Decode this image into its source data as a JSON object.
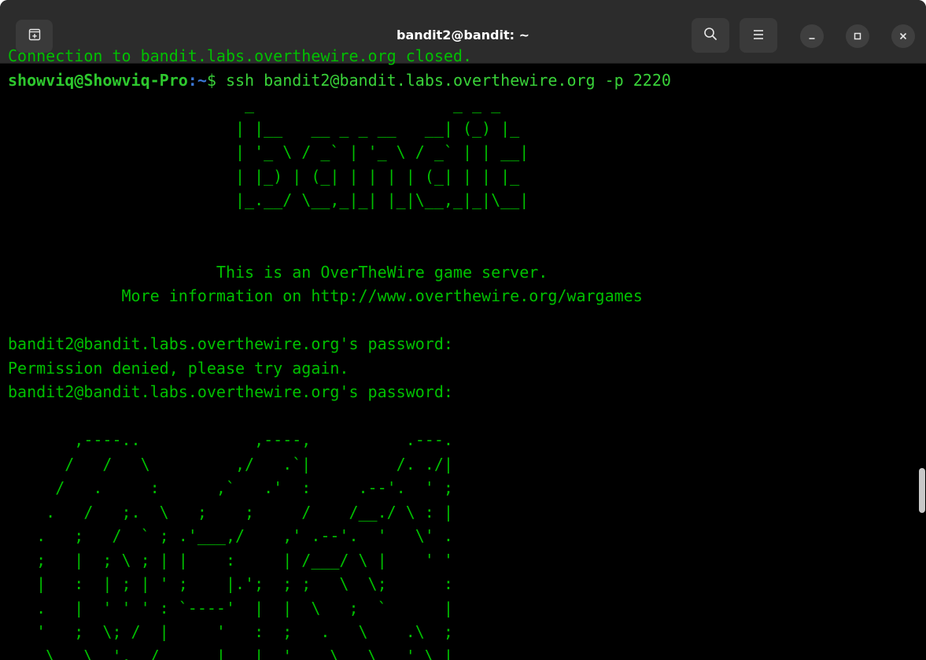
{
  "window": {
    "title": "bandit2@bandit: ~",
    "icons": {
      "new_tab": "new-tab-icon",
      "search": "search-icon",
      "menu": "hamburger-menu-icon",
      "minimize": "minimize-icon",
      "maximize": "maximize-icon",
      "close": "close-icon"
    }
  },
  "terminal": {
    "cut_line": "Connection to bandit.labs.overthewire.org closed.",
    "prompt_user": "showviq@Showviq-Pro",
    "prompt_sep": ":",
    "prompt_path": "~",
    "prompt_symbol": "$ ",
    "command": "ssh bandit2@bandit.labs.overthewire.org -p 2220",
    "banner_art": [
      "                         _                     _ _ _",
      "                        | |__   __ _ _ __   __| (_) |_",
      "                        | '_ \\ / _` | '_ \\ / _` | | __|",
      "                        | |_) | (_| | | | | (_| | | |_",
      "                        |_.__/ \\__,_|_| |_|\\__,_|_|\\__|"
    ],
    "blank_lines": [
      ""
    ],
    "welcome_line": "                      This is an OverTheWire game server.",
    "info_line": "            More information on http://www.overthewire.org/wargames",
    "password_prompt_1": "bandit2@bandit.labs.overthewire.org's password:",
    "permission_denied": "Permission denied, please try again.",
    "password_prompt_2": "bandit2@bandit.labs.overthewire.org's password:",
    "logo_art": [
      "       ,----..            ,----,          .---.",
      "      /   /   \\         ,/   .`|         /. ./|",
      "     /   .     :      ,`   .'  :     .--'.  ' ;",
      "    .   /   ;.  \\   ;    ;     /    /__./ \\ : |",
      "   .   ;   /  ` ; .'___,/    ,' .--'.  '   \\' .",
      "   ;   |  ; \\ ; | |    :     | /___/ \\ |    ' '",
      "   |   :  | ; | ' ;    |.';  ; ;   \\  \\;      :",
      "   .   |  ' ' ' : `----'  |  |  \\   ;  `      |",
      "   '   ;  \\; /  |     '   :  ;   .   \\    .\\  ;",
      "    \\   \\  ',  /      |   |  '    \\   \\   ' \\ |"
    ]
  }
}
